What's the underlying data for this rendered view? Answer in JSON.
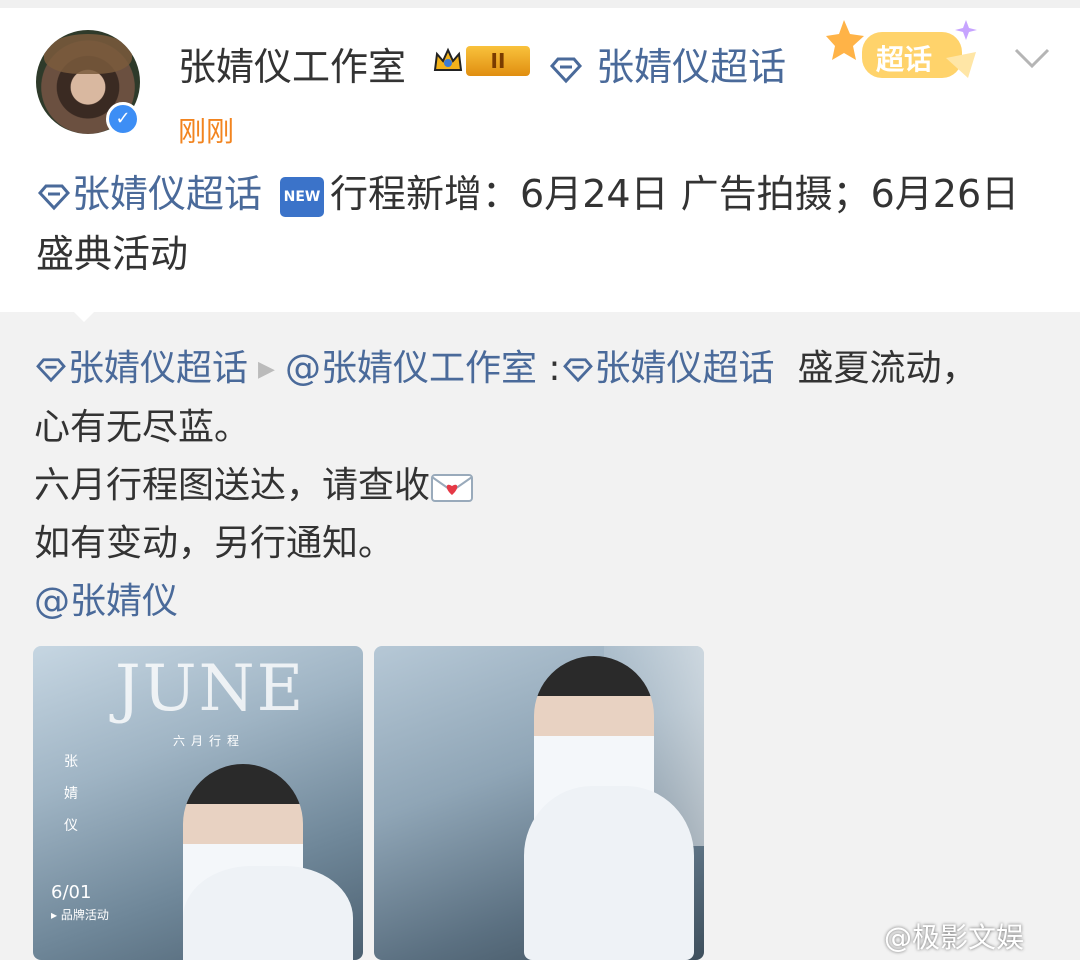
{
  "post": {
    "username": "张婧仪工作室",
    "rank_badge": "II",
    "topic_link": "张婧仪超话",
    "super_badge_label": "超话",
    "time": "刚刚",
    "body_topic": "张婧仪超话",
    "new_tag": "NEW",
    "body_text": "行程新增：6月24日 广告拍摄；6月26日 盛典活动"
  },
  "repost": {
    "topic": "张婧仪超话",
    "author_mention": "@张婧仪工作室",
    "colon": " :",
    "inner_topic": "张婧仪超话",
    "line1_text": "盛夏流动，",
    "line2": "心有无尽蓝。",
    "line3": "六月行程图送达，请查收",
    "line4": "如有变动，另行通知。",
    "mention": "@张婧仪"
  },
  "photos": [
    {
      "title": "JUNE",
      "subtitle": "六月行程",
      "vertical_name": "张 婧 仪",
      "date_label": "6/01",
      "event_label": "▸ 品牌活动"
    },
    {}
  ],
  "watermark": "@极影文娱",
  "colors": {
    "link": "#4a6a9a",
    "time": "#f2841f",
    "verify": "#3d8ef5"
  }
}
